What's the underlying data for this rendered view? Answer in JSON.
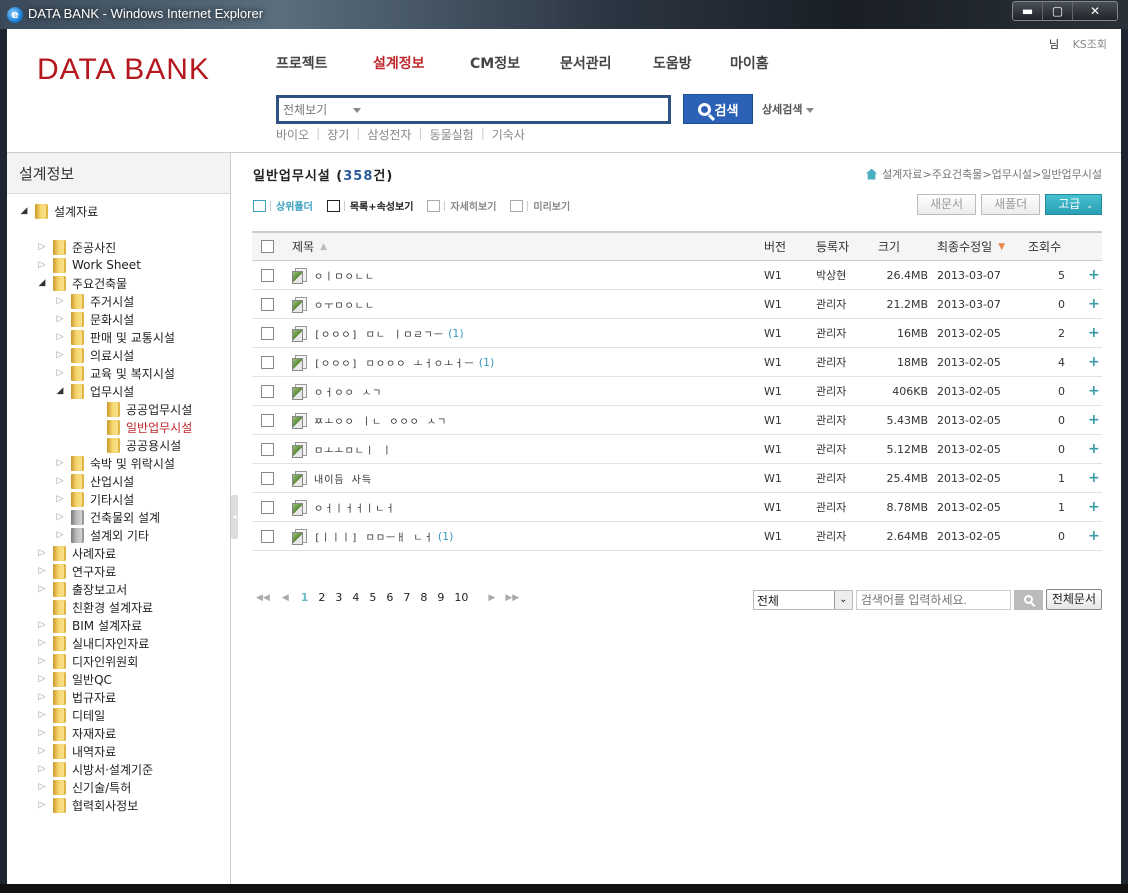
{
  "window": {
    "title": "DATA BANK - Windows Internet Explorer",
    "buttons": {
      "minimize": "▬",
      "maximize": "▢",
      "close": "✕"
    }
  },
  "header": {
    "logo": "DATA BANK",
    "nav": [
      {
        "label": "프로젝트",
        "active": false
      },
      {
        "label": "설계정보",
        "active": true
      },
      {
        "label": "CM정보",
        "active": false
      },
      {
        "label": "문서관리",
        "active": false
      },
      {
        "label": "도움방",
        "active": false
      },
      {
        "label": "마이홈",
        "active": false
      }
    ],
    "user_suffix": "님",
    "user_link": "KS조회",
    "search": {
      "scope": "전체보기",
      "value": "",
      "button": "검색",
      "advanced": "상세검색"
    },
    "keywords": [
      "바이오",
      "장기",
      "삼성전자",
      "동물실험",
      "기숙사"
    ]
  },
  "sidebar": {
    "title": "설계정보",
    "tree": [
      {
        "label": "설계자료",
        "level": 0,
        "toggle": "open",
        "folder": "yellow"
      },
      {
        "label": "준공사진",
        "level": 1,
        "toggle": "closed",
        "folder": "yellow"
      },
      {
        "label": "Work Sheet",
        "level": 1,
        "toggle": "closed",
        "folder": "yellow"
      },
      {
        "label": "주요건축물",
        "level": 1,
        "toggle": "open",
        "folder": "yellow"
      },
      {
        "label": "주거시설",
        "level": 2,
        "toggle": "closed",
        "folder": "yellow"
      },
      {
        "label": "문화시설",
        "level": 2,
        "toggle": "closed",
        "folder": "yellow"
      },
      {
        "label": "판매 및 교통시설",
        "level": 2,
        "toggle": "closed",
        "folder": "yellow"
      },
      {
        "label": "의료시설",
        "level": 2,
        "toggle": "closed",
        "folder": "yellow"
      },
      {
        "label": "교육 및 복지시설",
        "level": 2,
        "toggle": "closed",
        "folder": "yellow"
      },
      {
        "label": "업무시설",
        "level": 2,
        "toggle": "open",
        "folder": "yellow"
      },
      {
        "label": "공공업무시설",
        "level": 3,
        "toggle": "none",
        "folder": "yellow"
      },
      {
        "label": "일반업무시설",
        "level": 3,
        "toggle": "none",
        "folder": "yellow",
        "selected": true
      },
      {
        "label": "공공용시설",
        "level": 3,
        "toggle": "none",
        "folder": "yellow"
      },
      {
        "label": "숙박 및 위락시설",
        "level": 2,
        "toggle": "closed",
        "folder": "yellow"
      },
      {
        "label": "산업시설",
        "level": 2,
        "toggle": "closed",
        "folder": "yellow"
      },
      {
        "label": "기타시설",
        "level": 2,
        "toggle": "closed",
        "folder": "yellow"
      },
      {
        "label": "건축물외 설계",
        "level": 2,
        "toggle": "closed",
        "folder": "gray"
      },
      {
        "label": "설계외 기타",
        "level": 2,
        "toggle": "closed",
        "folder": "gray"
      },
      {
        "label": "사례자료",
        "level": 1,
        "toggle": "closed",
        "folder": "yellow"
      },
      {
        "label": "연구자료",
        "level": 1,
        "toggle": "closed",
        "folder": "yellow"
      },
      {
        "label": "출장보고서",
        "level": 1,
        "toggle": "closed",
        "folder": "yellow"
      },
      {
        "label": "친환경 설계자료",
        "level": 1,
        "toggle": "none",
        "folder": "yellow"
      },
      {
        "label": "BIM 설계자료",
        "level": 1,
        "toggle": "closed",
        "folder": "yellow"
      },
      {
        "label": "실내디자인자료",
        "level": 1,
        "toggle": "closed",
        "folder": "yellow"
      },
      {
        "label": "디자인위원회",
        "level": 1,
        "toggle": "closed",
        "folder": "yellow"
      },
      {
        "label": "일반QC",
        "level": 1,
        "toggle": "closed",
        "folder": "yellow"
      },
      {
        "label": "법규자료",
        "level": 1,
        "toggle": "closed",
        "folder": "yellow"
      },
      {
        "label": "디테일",
        "level": 1,
        "toggle": "closed",
        "folder": "yellow"
      },
      {
        "label": "자재자료",
        "level": 1,
        "toggle": "closed",
        "folder": "yellow"
      },
      {
        "label": "내역자료",
        "level": 1,
        "toggle": "closed",
        "folder": "yellow"
      },
      {
        "label": "시방서·설계기준",
        "level": 1,
        "toggle": "closed",
        "folder": "yellow"
      },
      {
        "label": "신기술/특허",
        "level": 1,
        "toggle": "closed",
        "folder": "yellow"
      },
      {
        "label": "협력회사정보",
        "level": 1,
        "toggle": "closed",
        "folder": "yellow"
      }
    ]
  },
  "main": {
    "title": "일반업무시설",
    "count": "358",
    "count_suffix": "건",
    "breadcrumb": "설계자료>주요건축물>업무시설>일반업무시설",
    "toolbar": [
      {
        "label": "상위폴더",
        "icon": "folder-up-icon",
        "state": "up"
      },
      {
        "label": "목록+속성보기",
        "icon": "list-properties-icon",
        "state": "active"
      },
      {
        "label": "자세히보기",
        "icon": "detail-view-icon",
        "state": "inactive"
      },
      {
        "label": "미리보기",
        "icon": "preview-icon",
        "state": "inactive"
      }
    ],
    "buttons": {
      "new_doc": "새문서",
      "new_folder": "새폴더",
      "advanced": "고급"
    },
    "columns": {
      "title": "제목",
      "version": "버전",
      "registrant": "등록자",
      "size": "크기",
      "modified": "최종수정일",
      "views": "조회수"
    },
    "rows": [
      {
        "title": "ㅇㅣㅁㅇㄴㄴ",
        "attach": "",
        "version": "W1",
        "registrant": "박상현",
        "size": "26.4MB",
        "modified": "2013-03-07",
        "views": "5"
      },
      {
        "title": "ㅇㅜㅁㅇㄴㄴ",
        "attach": "",
        "version": "W1",
        "registrant": "관리자",
        "size": "21.2MB",
        "modified": "2013-03-07",
        "views": "0"
      },
      {
        "title": "[ㅇㅇㅇ] ㅁㄴ ㅣㅁㄹㄱㅡ",
        "attach": "(1)",
        "version": "W1",
        "registrant": "관리자",
        "size": "16MB",
        "modified": "2013-02-05",
        "views": "2"
      },
      {
        "title": "[ㅇㅇㅇ] ㅁㅇㅇㅇ ㅗㅓㅇㅗㅓㅡ",
        "attach": "(1)",
        "version": "W1",
        "registrant": "관리자",
        "size": "18MB",
        "modified": "2013-02-05",
        "views": "4"
      },
      {
        "title": "ㅇㅓㅇㅇ ㅅㄱ",
        "attach": "",
        "version": "W1",
        "registrant": "관리자",
        "size": "406KB",
        "modified": "2013-02-05",
        "views": "0"
      },
      {
        "title": "ㅉㅗㅇㅇ ㅣㄴ ㅇㅇㅇ ㅅㄱ",
        "attach": "",
        "version": "W1",
        "registrant": "관리자",
        "size": "5.43MB",
        "modified": "2013-02-05",
        "views": "0"
      },
      {
        "title": "ㅁㅗㅗㅁㄴㅣ ㅣ",
        "attach": "",
        "version": "W1",
        "registrant": "관리자",
        "size": "5.12MB",
        "modified": "2013-02-05",
        "views": "0"
      },
      {
        "title": "내이듬 사득",
        "attach": "",
        "version": "W1",
        "registrant": "관리자",
        "size": "25.4MB",
        "modified": "2013-02-05",
        "views": "1"
      },
      {
        "title": "ㅇㅓㅣㅓㅓㅣㄴㅓ",
        "attach": "",
        "version": "W1",
        "registrant": "관리자",
        "size": "8.78MB",
        "modified": "2013-02-05",
        "views": "1"
      },
      {
        "title": "[ㅣㅣㅣ] ㅁㅁㅡㅐ ㄴㅓ",
        "attach": "(1)",
        "version": "W1",
        "registrant": "관리자",
        "size": "2.64MB",
        "modified": "2013-02-05",
        "views": "0"
      }
    ],
    "pager": {
      "pages": [
        "1",
        "2",
        "3",
        "4",
        "5",
        "6",
        "7",
        "8",
        "9",
        "10"
      ],
      "current": "1"
    },
    "bottom_search": {
      "scope": "전체",
      "placeholder": "검색어를 입력하세요.",
      "all_docs": "전체문서"
    }
  }
}
